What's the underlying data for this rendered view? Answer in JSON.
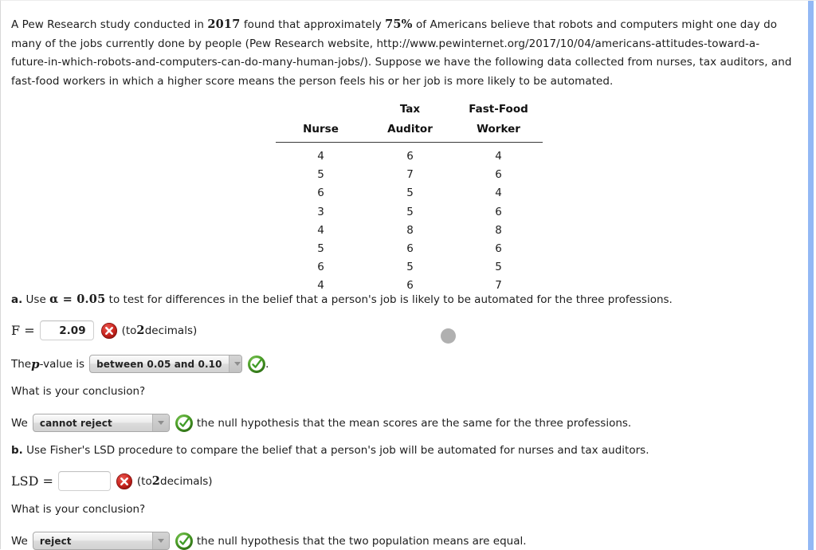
{
  "intro": {
    "part1": "A Pew Research study conducted in ",
    "year": "2017",
    "part2": " found that approximately ",
    "pct": "75%",
    "part3": " of Americans believe that robots and computers might one day do many of the jobs currently done by people (Pew Research website, http://www.pewinternet.org/2017/10/04/americans-attitudes-toward-a-future-in-which-robots-and-computers-can-do-many-human-jobs/). Suppose we have the following data collected from nurses, tax auditors, and fast-food workers in which a higher score means the person feels his or her job is more likely to be automated."
  },
  "table": {
    "headers_top": [
      "",
      "Tax",
      "Fast-Food"
    ],
    "headers_bottom": [
      "Nurse",
      "Auditor",
      "Worker"
    ],
    "columns": [
      "Nurse",
      "Tax Auditor",
      "Fast-Food Worker"
    ],
    "rows": [
      [
        "4",
        "6",
        "4"
      ],
      [
        "5",
        "7",
        "6"
      ],
      [
        "6",
        "5",
        "4"
      ],
      [
        "3",
        "5",
        "6"
      ],
      [
        "4",
        "8",
        "8"
      ],
      [
        "5",
        "6",
        "6"
      ],
      [
        "6",
        "5",
        "5"
      ],
      [
        "4",
        "6",
        "7"
      ]
    ]
  },
  "part_a": {
    "label": "a.",
    "text_before_alpha": " Use ",
    "alpha": "α = 0.05",
    "text_after_alpha": " to test for differences in the belief that a person's job is likely to be automated for the three professions.",
    "f_label": "F =",
    "f_value": "2.09",
    "f_status": "incorrect",
    "f_hint_open": "(to ",
    "f_hint_num": "2",
    "f_hint_close": " decimals)",
    "pvalue_prefix_1": "The ",
    "pvalue_p": "p",
    "pvalue_prefix_2": "-value is",
    "pvalue_selected": "between 0.05 and 0.10",
    "pvalue_status": "correct",
    "pvalue_trail": ".",
    "conclusion_prompt": "What is your conclusion?",
    "we_label": "We",
    "conclusion_selected": "cannot reject",
    "conclusion_status": "correct",
    "conclusion_text": "the null hypothesis that the mean scores are the same for the three professions."
  },
  "part_b": {
    "label": "b.",
    "text": " Use Fisher's LSD procedure to compare the belief that a person's job will be automated for nurses and tax auditors.",
    "lsd_label": "LSD =",
    "lsd_value": "",
    "lsd_status": "incorrect",
    "lsd_hint_open": "(to ",
    "lsd_hint_num": "2",
    "lsd_hint_close": " decimals)",
    "conclusion_prompt": "What is your conclusion?",
    "we_label": "We",
    "conclusion_selected": "reject",
    "conclusion_status": "correct",
    "conclusion_text": "the null hypothesis that the two population means are equal."
  },
  "colors": {
    "status_correct": "#3f9c27",
    "status_incorrect": "#c0241f",
    "scrollbar": "#93b8f5",
    "cursor_dot": "#b0b0b0"
  }
}
